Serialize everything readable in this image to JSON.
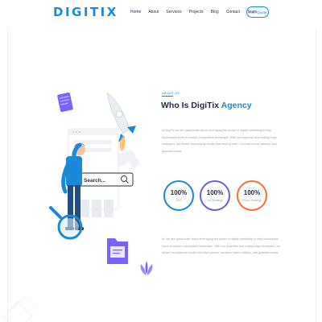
{
  "brand": {
    "logo": "DIGITIX",
    "color": "#1a8ad8"
  },
  "nav": {
    "items": [
      "Home",
      "About",
      "Services",
      "Projects",
      "Blog",
      "Contact",
      "Team"
    ],
    "cta": "Free Quote"
  },
  "about": {
    "eyebrow": "ABOUT US",
    "title_main": "Who Is DigiTix ",
    "title_accent": "Agency",
    "para1": "At DigiTix we are passionate about leveraging the power of digital marketing to help businesses thrive in today's competitive landscape. With our expertise and cutting-edge strategies, we deliver exceptional results that drive growth, increase brand visibility, and generate leads.",
    "para2": "At, we are passionate about leveraging the power of digital marketing to help businesses thrive in today's competitive landscape. With our expertise and cutting-edge strategies, we deliver exceptional results that drive growth, increase brand visibility, and generate leads."
  },
  "stats": [
    {
      "value": "100%",
      "label": "SEO",
      "color": "#1a8ad8"
    },
    {
      "value": "100%",
      "label": "Ad Strategy",
      "color": "#6c5ce7"
    },
    {
      "value": "100%",
      "label": "Photo Strategy",
      "color": "#ff6b35"
    }
  ],
  "illustration": {
    "search_text": "Search...",
    "icons": [
      "rocket-icon",
      "magnifier-icon",
      "folder-icon",
      "document-icon",
      "plant-icon"
    ]
  }
}
